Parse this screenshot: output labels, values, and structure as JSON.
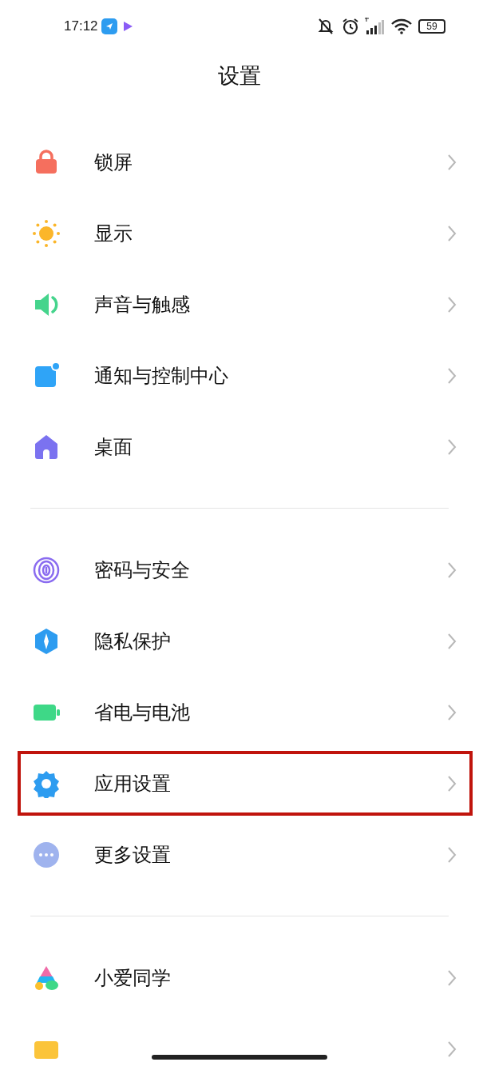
{
  "status_bar": {
    "time": "17:12",
    "battery": "59"
  },
  "title": "设置",
  "groups": [
    {
      "items": [
        {
          "kind": "lock",
          "label": "锁屏",
          "highlighted": false
        },
        {
          "kind": "sun",
          "label": "显示",
          "highlighted": false
        },
        {
          "kind": "speaker",
          "label": "声音与触感",
          "highlighted": false
        },
        {
          "kind": "notification",
          "label": "通知与控制中心",
          "highlighted": false
        },
        {
          "kind": "home",
          "label": "桌面",
          "highlighted": false
        }
      ]
    },
    {
      "items": [
        {
          "kind": "fingerprint",
          "label": "密码与安全",
          "highlighted": false
        },
        {
          "kind": "privacy",
          "label": "隐私保护",
          "highlighted": false
        },
        {
          "kind": "battery",
          "label": "省电与电池",
          "highlighted": false
        },
        {
          "kind": "gear",
          "label": "应用设置",
          "highlighted": true
        },
        {
          "kind": "more",
          "label": "更多设置",
          "highlighted": false
        }
      ]
    },
    {
      "items": [
        {
          "kind": "assistant",
          "label": "小爱同学",
          "highlighted": false
        },
        {
          "kind": "wallet",
          "highlighted": false
        }
      ]
    }
  ]
}
